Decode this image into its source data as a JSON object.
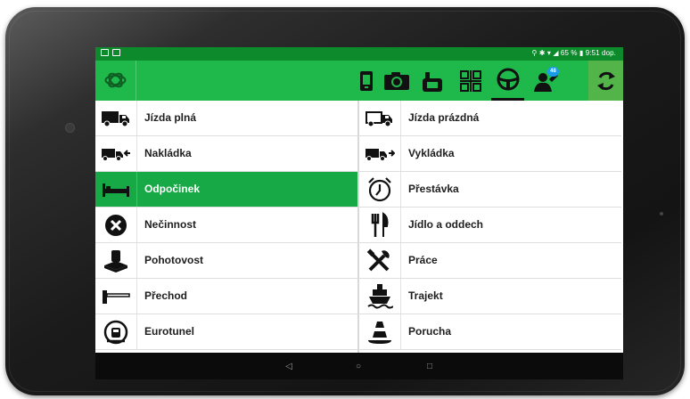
{
  "status_bar": {
    "battery_percent": "65 %",
    "time": "9:51 dop."
  },
  "toolbar": {
    "logo_icon": "tachograph-logo-icon",
    "buttons": [
      {
        "icon": "phone-card-icon"
      },
      {
        "icon": "camera-icon"
      },
      {
        "icon": "tachograph-icon"
      },
      {
        "icon": "barcode-icon"
      },
      {
        "icon": "steering-wheel-icon",
        "active": true
      },
      {
        "icon": "message-person-icon",
        "badge": "48"
      },
      {
        "icon": "sync-icon"
      }
    ],
    "colors": {
      "toolbar": "#1fb84a",
      "status": "#0d8a2c",
      "active_row": "#17a945"
    }
  },
  "activities": {
    "left": [
      {
        "label": "Jízda plná",
        "icon": "loaded-truck-icon"
      },
      {
        "label": "Nakládka",
        "icon": "loading-truck-icon"
      },
      {
        "label": "Odpočinek",
        "icon": "bed-icon",
        "active": true
      },
      {
        "label": "Nečinnost",
        "icon": "x-circle-icon"
      },
      {
        "label": "Pohotovost",
        "icon": "standby-icon"
      },
      {
        "label": "Přechod",
        "icon": "border-crossing-icon"
      },
      {
        "label": "Eurotunel",
        "icon": "eurotunnel-icon"
      }
    ],
    "right": [
      {
        "label": "Jízda prázdná",
        "icon": "empty-truck-icon"
      },
      {
        "label": "Vykládka",
        "icon": "unloading-truck-icon"
      },
      {
        "label": "Přestávka",
        "icon": "alarm-clock-icon"
      },
      {
        "label": "Jídlo a oddech",
        "icon": "cutlery-icon"
      },
      {
        "label": "Práce",
        "icon": "tools-icon"
      },
      {
        "label": "Trajekt",
        "icon": "ferry-icon"
      },
      {
        "label": "Porucha",
        "icon": "traffic-cone-icon"
      }
    ]
  },
  "nav_bar": {
    "back_glyph": "◁",
    "home_glyph": "○",
    "recents_glyph": "□"
  }
}
